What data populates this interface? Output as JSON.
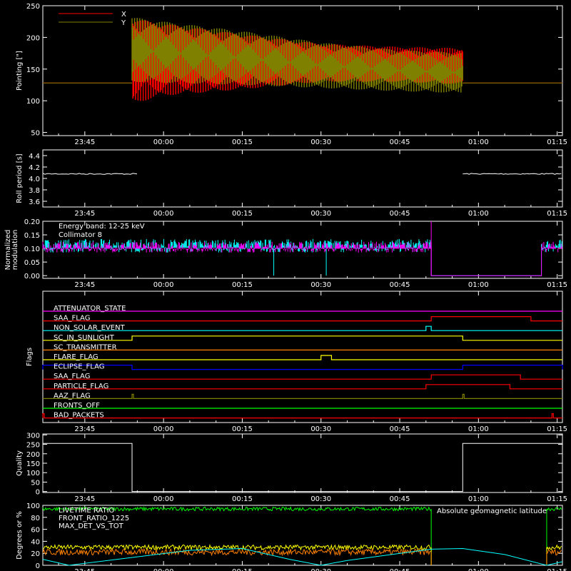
{
  "colors": {
    "background": "#000000",
    "axes": "#ffffff",
    "red": "#ff0000",
    "olive": "#808000",
    "white": "#ffffff",
    "cyan": "#00ffff",
    "magenta": "#ff00ff",
    "orange": "#ff8000",
    "yellow": "#ffff00",
    "blue": "#0000ff",
    "green": "#00ff00",
    "darkgreen": "#00a000"
  },
  "time_ticks": [
    "23:45",
    "00:00",
    "00:15",
    "00:30",
    "00:45",
    "01:00",
    "01:15"
  ],
  "chart_data": [
    {
      "type": "line",
      "id": "pointing",
      "ylabel": "Pointing [\"]",
      "ylim": [
        45,
        250
      ],
      "yticks": [
        50,
        100,
        150,
        200,
        250
      ],
      "legend": [
        "X",
        "Y"
      ],
      "legend_position": "top-left",
      "series": [
        {
          "name": "X",
          "color": "#ff0000",
          "description": "oscillating envelope",
          "t_start": "23:54",
          "t_end": "00:57",
          "before_after_value": 128,
          "envelope": [
            [
              "23:54",
              95,
              230
            ],
            [
              "00:00",
              108,
              222
            ],
            [
              "00:15",
              118,
              205
            ],
            [
              "00:30",
              130,
              190
            ],
            [
              "00:45",
              130,
              185
            ],
            [
              "00:57",
              126,
              183
            ]
          ]
        },
        {
          "name": "Y",
          "color": "#808000",
          "description": "oscillating envelope",
          "t_start": "23:54",
          "t_end": "00:57",
          "before_after_value": 128,
          "envelope": [
            [
              "23:54",
              130,
              232
            ],
            [
              "00:00",
              128,
              225
            ],
            [
              "00:15",
              125,
              210
            ],
            [
              "00:30",
              120,
              192
            ],
            [
              "00:45",
              115,
              180
            ],
            [
              "00:57",
              112,
              176
            ]
          ]
        }
      ]
    },
    {
      "type": "line",
      "id": "roll",
      "ylabel": "Roll period [s]",
      "ylim": [
        3.5,
        4.5
      ],
      "yticks": [
        3.6,
        3.8,
        4.0,
        4.2,
        4.4
      ],
      "series": [
        {
          "name": "roll period",
          "color": "#ffffff",
          "segments": [
            [
              "23:37",
              4.08,
              "23:55"
            ],
            [
              "00:57",
              4.08,
              "01:16"
            ]
          ]
        }
      ]
    },
    {
      "type": "line",
      "id": "modulation",
      "ylabel": "Normalized modulation",
      "ylim": [
        -0.01,
        0.2
      ],
      "yticks": [
        0.0,
        0.05,
        0.1,
        0.15,
        0.2
      ],
      "annotations": [
        "Energy band: 12-25 keV",
        "Collimator 8"
      ],
      "series": [
        {
          "name": "Collimator 8",
          "color": "#00ffff",
          "mean": 0.11,
          "noise": 0.025,
          "active": [
            [
              "23:37",
              "00:51"
            ],
            [
              "01:12",
              "01:16"
            ]
          ]
        },
        {
          "name": "modulation",
          "color": "#ff00ff",
          "mean": 0.105,
          "noise": 0.02,
          "active": [
            [
              "23:37",
              "00:51"
            ],
            [
              "01:12",
              "01:16"
            ]
          ]
        }
      ]
    },
    {
      "type": "step",
      "id": "flags",
      "ylabel": "Flags",
      "flags": [
        {
          "name": "ATTENUATOR_STATE",
          "color": "#ff00ff",
          "steps": []
        },
        {
          "name": "SAA_FLAG",
          "color": "#ff0000",
          "steps": [
            [
              "00:51",
              "01:10"
            ]
          ]
        },
        {
          "name": "NON_SOLAR_EVENT",
          "color": "#00ffff",
          "steps": [
            [
              "00:50",
              "00:51"
            ]
          ]
        },
        {
          "name": "SC_IN_SUNLIGHT",
          "color": "#ffff00",
          "steps": [
            [
              "23:54",
              "00:57"
            ]
          ]
        },
        {
          "name": "SC_TRANSMITTER",
          "color": "#ff8000",
          "steps": []
        },
        {
          "name": "FLARE_FLAG",
          "color": "#ffff00",
          "steps": [
            [
              "00:30",
              "00:32"
            ]
          ]
        },
        {
          "name": "ECLIPSE_FLAG",
          "color": "#0000ff",
          "steps": [
            [
              "23:37",
              "23:54"
            ],
            [
              "00:57",
              "01:16"
            ]
          ]
        },
        {
          "name": "SAA_FLAG",
          "color": "#ff0000",
          "steps": [
            [
              "00:51",
              "01:08"
            ]
          ]
        },
        {
          "name": "PARTICLE_FLAG",
          "color": "#ff0000",
          "steps": [
            [
              "00:50",
              "01:06"
            ]
          ]
        },
        {
          "name": "AAZ_FLAG",
          "color": "#808000",
          "steps": [
            [
              "23:54",
              "23:54"
            ],
            [
              "00:57",
              "00:57"
            ]
          ]
        },
        {
          "name": "FRONTS_OFF",
          "color": "#00ff00",
          "steps": []
        },
        {
          "name": "BAD_PACKETS",
          "color": "#ff0000",
          "steps": [
            [
              "23:37",
              "23:37"
            ],
            [
              "01:14",
              "01:14"
            ]
          ]
        }
      ]
    },
    {
      "type": "step",
      "id": "quality",
      "ylabel": "Quality",
      "ylim": [
        -5,
        305
      ],
      "yticks": [
        0,
        50,
        100,
        150,
        200,
        250,
        300
      ],
      "series": [
        {
          "name": "quality",
          "color": "#ffffff",
          "points": [
            [
              "23:37",
              255
            ],
            [
              "23:54",
              255
            ],
            [
              "23:54",
              0
            ],
            [
              "00:57",
              0
            ],
            [
              "00:57",
              255
            ],
            [
              "01:16",
              255
            ]
          ]
        }
      ]
    },
    {
      "type": "line",
      "id": "ratios",
      "ylabel": "Degrees or %",
      "ylim": [
        0,
        100
      ],
      "yticks": [
        0,
        20,
        40,
        60,
        80,
        100
      ],
      "legend": [
        "LIVETIME RATIO",
        "FRONT_RATIO_1225",
        "MAX_DET_VS_TOT"
      ],
      "annotations": [
        "Absolute geomagnetic latitude"
      ],
      "series": [
        {
          "name": "LIVETIME RATIO",
          "color": "#00ff00",
          "mean": 94,
          "noise": 3,
          "active": [
            [
              "23:37",
              "00:51"
            ],
            [
              "01:13",
              "01:16"
            ]
          ]
        },
        {
          "name": "FRONT_RATIO_1225",
          "color": "#ffff00",
          "mean": 30,
          "noise": 4,
          "active": [
            [
              "23:37",
              "00:51"
            ],
            [
              "01:13",
              "01:16"
            ]
          ]
        },
        {
          "name": "MAX_DET_VS_TOT",
          "color": "#ff8000",
          "mean": 22,
          "noise": 5,
          "active": [
            [
              "23:37",
              "00:51"
            ],
            [
              "01:13",
              "01:16"
            ]
          ]
        },
        {
          "name": "Absolute geomagnetic latitude",
          "color": "#00ffff",
          "description": "triangle wave 0-30 deg",
          "points": [
            [
              "23:37",
              10
            ],
            [
              "23:42",
              0
            ],
            [
              "00:05",
              25
            ],
            [
              "00:15",
              28
            ],
            [
              "00:24",
              10
            ],
            [
              "00:30",
              0
            ],
            [
              "00:35",
              8
            ],
            [
              "00:51",
              27
            ],
            [
              "00:57",
              28
            ],
            [
              "01:05",
              18
            ],
            [
              "01:13",
              0
            ],
            [
              "01:16",
              6
            ]
          ]
        }
      ]
    }
  ]
}
